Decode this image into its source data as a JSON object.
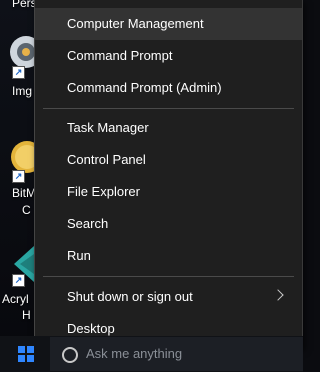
{
  "desktop": {
    "icons": [
      {
        "label": "Perso"
      },
      {
        "label": "Img"
      },
      {
        "label": "BitM"
      },
      {
        "label": "C"
      },
      {
        "label": "Acryl"
      },
      {
        "label": "H"
      }
    ]
  },
  "menu": {
    "group1": [
      "Computer Management",
      "Command Prompt",
      "Command Prompt (Admin)"
    ],
    "group2": [
      "Task Manager",
      "Control Panel",
      "File Explorer",
      "Search",
      "Run"
    ],
    "group3": [
      "Shut down or sign out",
      "Desktop"
    ]
  },
  "taskbar": {
    "search_placeholder": "Ask me anything"
  },
  "colors": {
    "menu_bg": "#1f1f1f",
    "menu_hover": "#333333",
    "accent": "#2f86ff"
  }
}
